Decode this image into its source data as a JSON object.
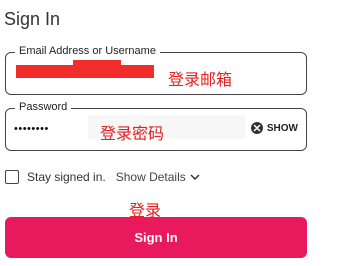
{
  "title": "Sign In",
  "email": {
    "label": "Email Address or Username",
    "annotation": "登录邮箱",
    "redaction_color": "#f22b2b"
  },
  "password": {
    "label": "Password",
    "value": "••••••••",
    "annotation": "登录密码",
    "show_label": "SHOW",
    "show_icon": "x-circle-icon"
  },
  "stay_signed_in": {
    "label": "Stay signed in.",
    "checked": false,
    "details_label": "Show Details",
    "details_icon": "chevron-down-icon"
  },
  "login_annotation": "登录",
  "sign_in_button": "Sign In",
  "colors": {
    "accent": "#e8195d",
    "annotation": "#e52020"
  }
}
